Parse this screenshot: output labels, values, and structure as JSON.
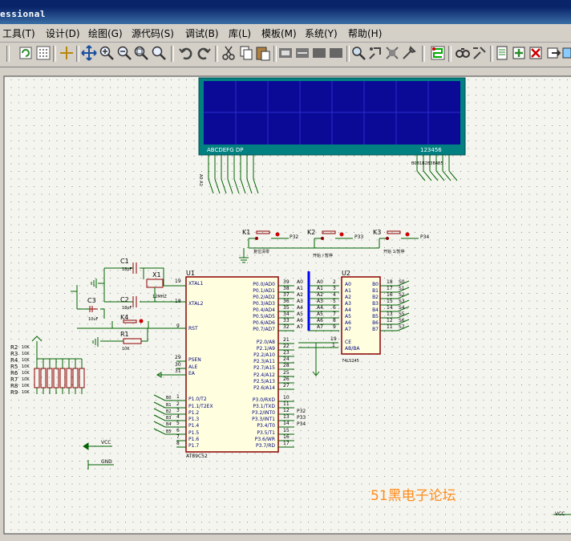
{
  "window": {
    "title_fragment": "essional"
  },
  "menu": [
    {
      "label": "工具(T)"
    },
    {
      "label": "设计(D)"
    },
    {
      "label": "绘图(G)"
    },
    {
      "label": "源代码(S)"
    },
    {
      "label": "调试(B)"
    },
    {
      "label": "库(L)"
    },
    {
      "label": "模板(M)"
    },
    {
      "label": "系统(Y)"
    },
    {
      "label": "帮助(H)"
    }
  ],
  "toolbar_icons": [
    "refresh-icon",
    "grid-icon",
    "origin-icon",
    "pan-icon",
    "zoom-in-icon",
    "zoom-out-icon",
    "zoom-all-icon",
    "zoom-area-icon",
    "undo-icon",
    "redo-icon",
    "cut-icon",
    "copy-icon",
    "paste-icon",
    "block-copy-icon",
    "block-move-icon",
    "block-rotate-icon",
    "block-delete-icon",
    "pick-device-icon",
    "make-device-icon",
    "package-icon",
    "decompose-icon",
    "wire-autorouter-icon",
    "search-tag-icon",
    "property-assign-icon",
    "new-sheet-icon",
    "remove-sheet-icon",
    "goto-sheet-icon",
    "export-icon"
  ],
  "lcd": {
    "pins_left": "ABCDEFG  DP",
    "pins_right": "123456"
  },
  "buttons": {
    "k1": "K1",
    "k2": "K2",
    "k3": "K3",
    "k1_note": "复位清零",
    "k2_note": "开始 / 暂停",
    "k3_note": "开始 1/暂停",
    "p32": "P32",
    "p33": "P33",
    "p34": "P34"
  },
  "crystal": {
    "c1": "C1",
    "c1v": "18pF",
    "c2": "C2",
    "c2v": "18pF",
    "x1": "X1",
    "x1v": "12MHZ",
    "c3": "C3",
    "c3v": "10uF",
    "k4": "K4",
    "r1": "R1",
    "r1v": "10K"
  },
  "resistors": [
    "R2",
    "R3",
    "R4",
    "R5",
    "R6",
    "R7",
    "R8",
    "R9"
  ],
  "res_value": "10K",
  "u1": {
    "ref": "U1",
    "part": "AT89C52",
    "left": [
      "XTAL1",
      "XTAL2",
      "RST",
      "PSEN",
      "ALE",
      "EA",
      "P1.0/T2",
      "P1.1/T2EX",
      "P1.2",
      "P1.3",
      "P1.4",
      "P1.5",
      "P1.6",
      "P1.7"
    ],
    "left_nums": [
      "19",
      "18",
      "9",
      "29",
      "30",
      "31",
      "1",
      "2",
      "3",
      "4",
      "5",
      "6",
      "7",
      "8"
    ],
    "right": [
      "P0.0/AD0",
      "P0.1/AD1",
      "P0.2/AD2",
      "P0.3/AD3",
      "P0.4/AD4",
      "P0.5/AD5",
      "P0.6/AD6",
      "P0.7/AD7",
      "P2.0/A8",
      "P2.1/A9",
      "P2.2/A10",
      "P2.3/A11",
      "P2.4/A12",
      "P2.5/A13",
      "P2.6/A14",
      "P2.7/A15",
      "P3.0/RXD",
      "P3.1/TXD",
      "P3.2/INT0",
      "P3.3/INT1",
      "P3.4/T0",
      "P3.5/T1",
      "P3.6/WR",
      "P3.7/RD"
    ],
    "right_nums": [
      "39",
      "38",
      "37",
      "36",
      "35",
      "34",
      "33",
      "32",
      "21",
      "22",
      "23",
      "24",
      "25",
      "26",
      "27",
      "28",
      "10",
      "11",
      "12",
      "13",
      "14",
      "15",
      "16",
      "17"
    ],
    "p0_nets": [
      "A0",
      "A1",
      "A2",
      "A3",
      "A4",
      "A5",
      "A6",
      "A7"
    ],
    "p1_nets": [
      "B0",
      "B1",
      "B2",
      "B3",
      "B4",
      "B5"
    ],
    "p3_nets": [
      "P32",
      "P33",
      "P34"
    ]
  },
  "u2": {
    "ref": "U2",
    "part": "74LS245",
    "left": [
      "A0",
      "A1",
      "A2",
      "A3",
      "A4",
      "A5",
      "A6",
      "A7"
    ],
    "right": [
      "B0",
      "B1",
      "B2",
      "B3",
      "B4",
      "B5",
      "B6",
      "B7"
    ],
    "left_nums": [
      "2",
      "3",
      "4",
      "5",
      "6",
      "7",
      "8",
      "9"
    ],
    "right_nums": [
      "18",
      "17",
      "16",
      "15",
      "14",
      "13",
      "12",
      "11"
    ],
    "ctrl": [
      "CE",
      "AB/BA"
    ],
    "ctrl_nums": [
      "19",
      "1"
    ],
    "outputs": [
      "S0",
      "S1",
      "S2",
      "S3",
      "S4",
      "S5",
      "S6",
      "S7"
    ]
  },
  "power": {
    "vcc": "VCC",
    "gnd": "GND"
  },
  "watermark": "51黑电子论坛",
  "colors": {
    "sheet": "#f5f5f0",
    "wire": "#006400",
    "part": "#8b0000",
    "pin_text": "#000080",
    "lcd_bg": "#0a0a96",
    "lcd_frame": "#008080",
    "bus": "#0000ff",
    "watermark": "#ff8c1a"
  }
}
